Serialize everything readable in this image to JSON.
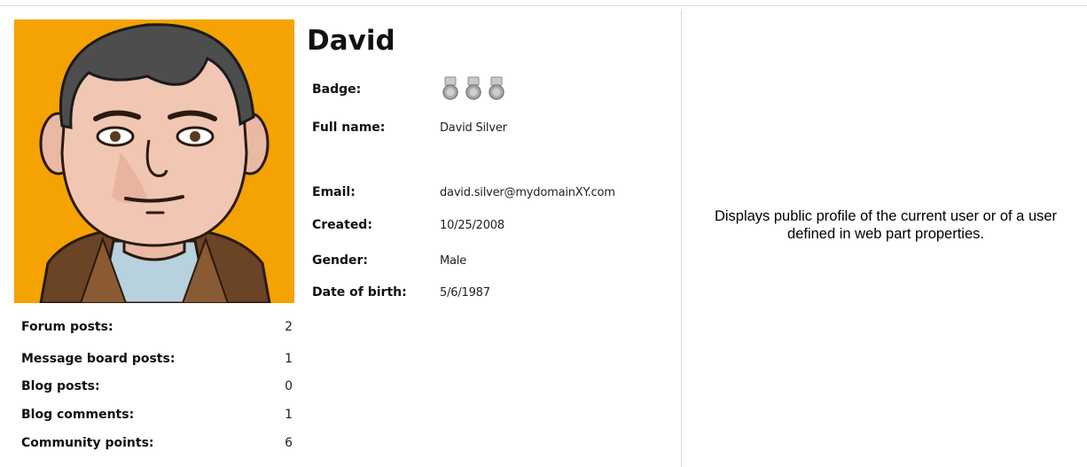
{
  "profile": {
    "display_name": "David",
    "fields": {
      "badge_label": "Badge:",
      "badge_icons": [
        "medal-icon",
        "medal-icon",
        "medal-icon"
      ],
      "full_name_label": "Full name:",
      "full_name_value": "David Silver",
      "email_label": "Email:",
      "email_value": "david.silver@mydomainXY.com",
      "created_label": "Created:",
      "created_value": "10/25/2008",
      "gender_label": "Gender:",
      "gender_value": "Male",
      "dob_label": "Date of birth:",
      "dob_value": "5/6/1987"
    },
    "stats": [
      {
        "label": "Forum posts:",
        "value": "2"
      },
      {
        "label": "Message board posts:",
        "value": "1"
      },
      {
        "label": "Blog posts:",
        "value": "0"
      },
      {
        "label": "Blog comments:",
        "value": "1"
      },
      {
        "label": "Community points:",
        "value": "6"
      }
    ]
  },
  "description": "Displays public profile of the current user or of a user defined in web part properties.",
  "colors": {
    "avatar_background": "#f5a203",
    "medal": "#a9a9a9"
  }
}
